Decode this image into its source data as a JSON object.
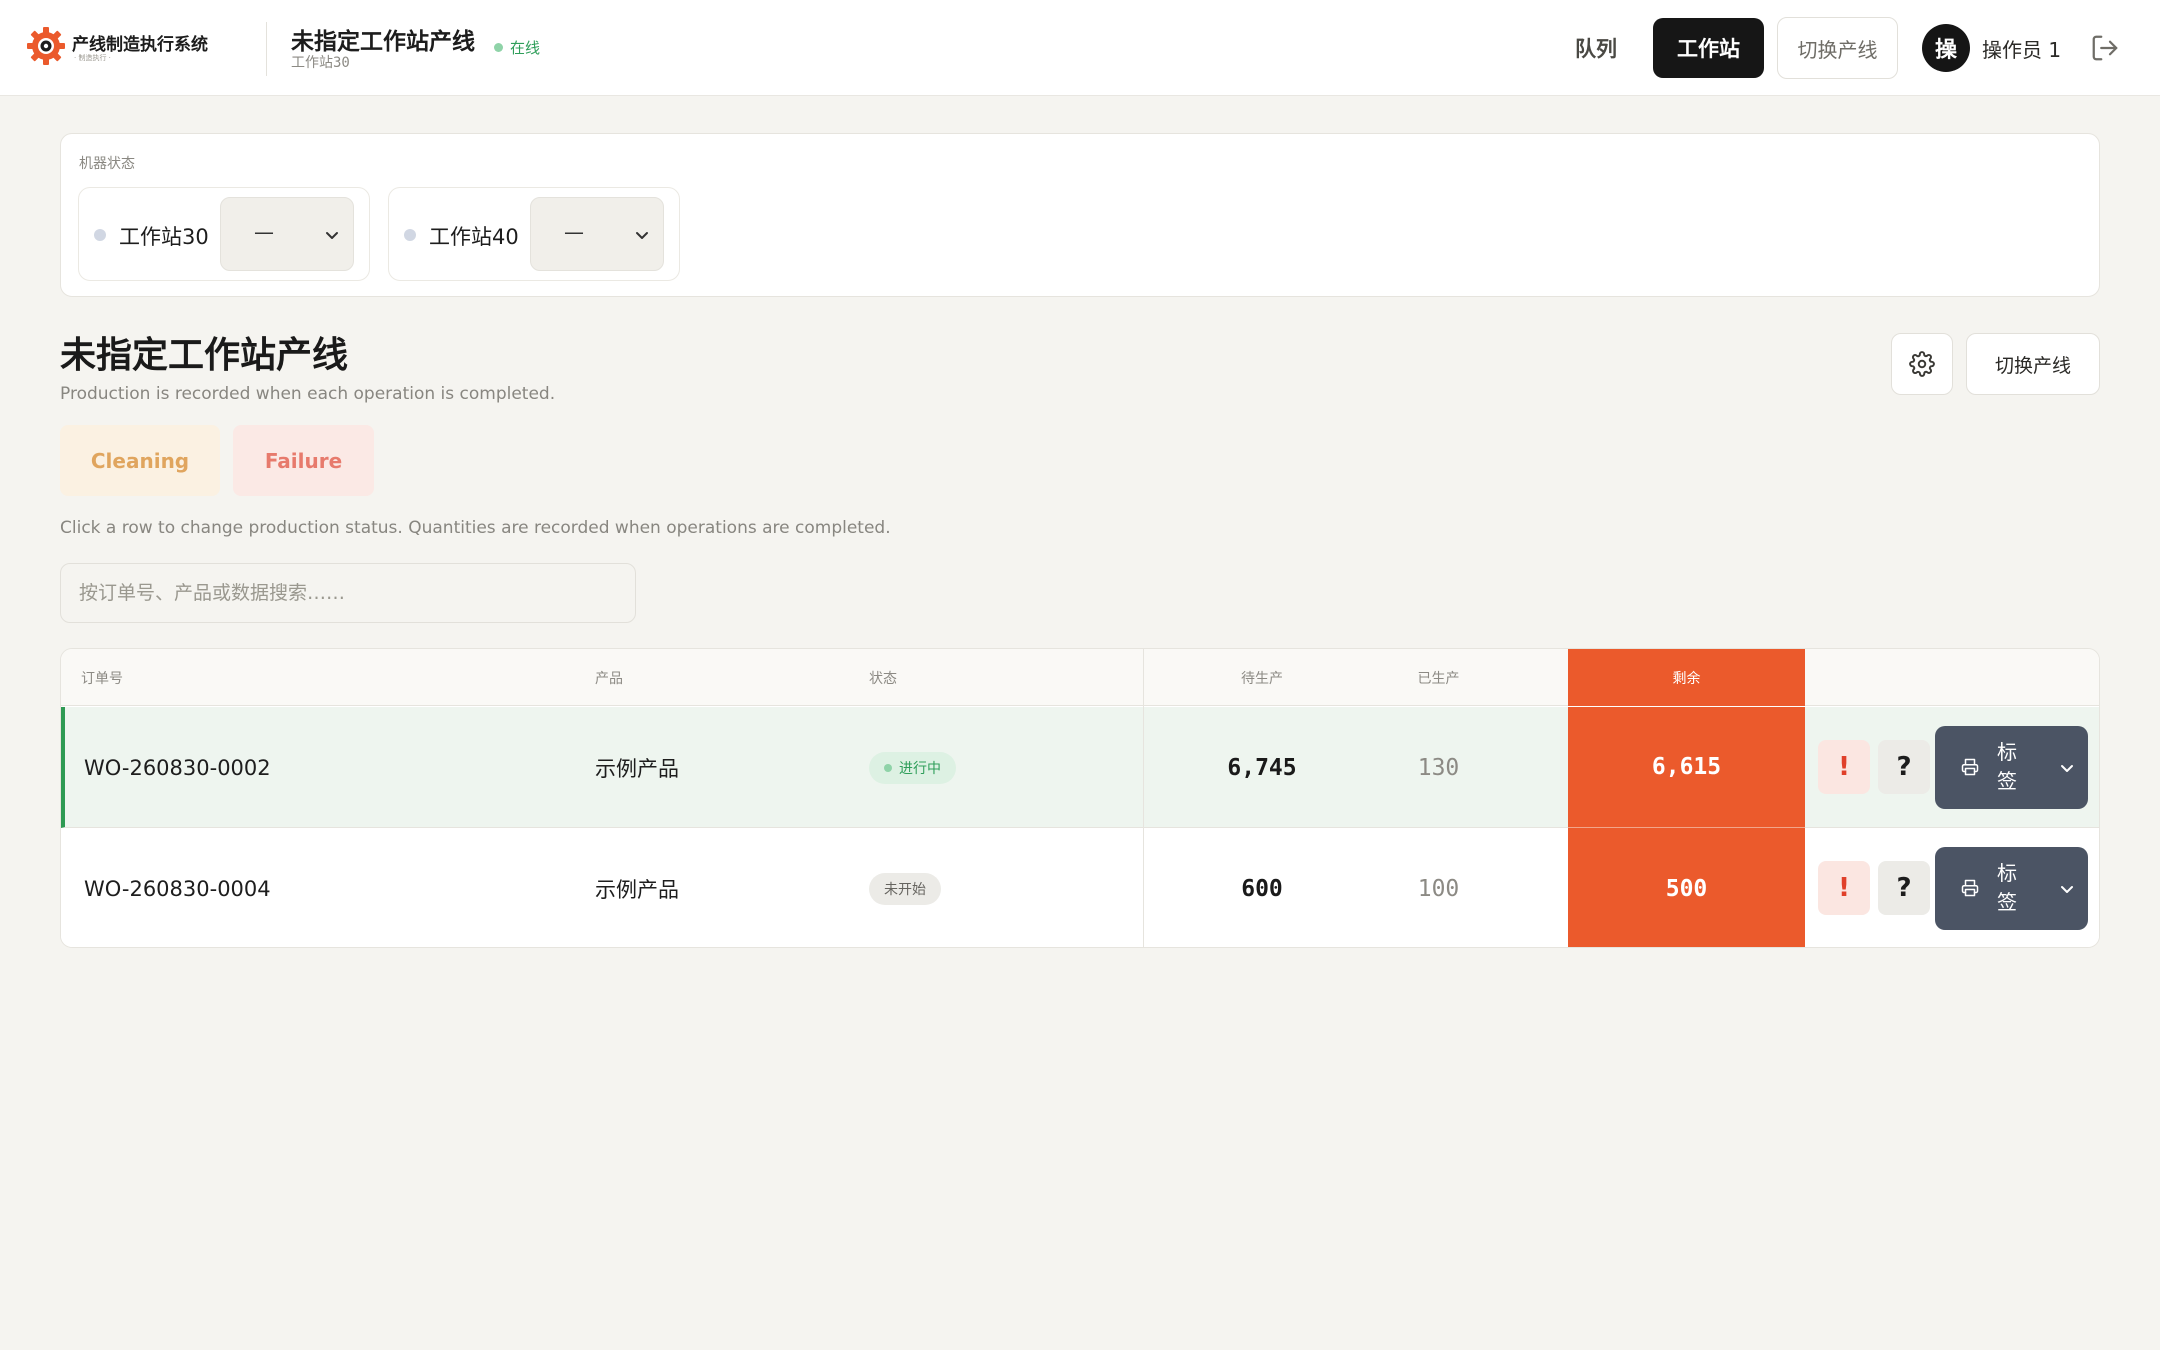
{
  "app": {
    "brand_name": "产线制造执行系统",
    "brand_sub": "· 制造执行 ·"
  },
  "header": {
    "line_title": "未指定工作站产线",
    "line_sub": "工作站30",
    "online_label": "在线",
    "nav": {
      "queue": "队列",
      "station": "工作站",
      "switch_line": "切换产线"
    },
    "operator_initial": "操",
    "operator_name": "操作员 1"
  },
  "machine_status": {
    "label": "机器状态",
    "stations": [
      {
        "name": "工作站30",
        "value": "—"
      },
      {
        "name": "工作站40",
        "value": "—"
      }
    ]
  },
  "page": {
    "title": "未指定工作站产线",
    "subtitle": "Production is recorded when each operation is completed.",
    "switch_button": "切换产线",
    "chips": {
      "cleaning": "Cleaning",
      "failure": "Failure"
    },
    "hint": "Click a row to change production status. Quantities are recorded when operations are completed.",
    "search_placeholder": "按订单号、产品或数据搜索……"
  },
  "table": {
    "columns": {
      "order": "订单号",
      "product": "产品",
      "status": "状态",
      "pending": "待生产",
      "produced": "已生产",
      "remaining": "剩余"
    },
    "rows": [
      {
        "order": "WO-260830-0002",
        "product": "示例产品",
        "status": "进行中",
        "pending": "6,745",
        "produced": "130",
        "remaining": "6,615",
        "alert": "!",
        "help": "?",
        "label_button": "标签"
      },
      {
        "order": "WO-260830-0004",
        "product": "示例产品",
        "status": "未开始",
        "pending": "600",
        "produced": "100",
        "remaining": "500",
        "alert": "!",
        "help": "?",
        "label_button": "标签"
      }
    ]
  },
  "colors": {
    "accent": "#eb5a2c",
    "active_nav": "#161616",
    "in_progress": "#2f9e5a",
    "label_button": "#4b5464",
    "alert": "#e0402a"
  }
}
